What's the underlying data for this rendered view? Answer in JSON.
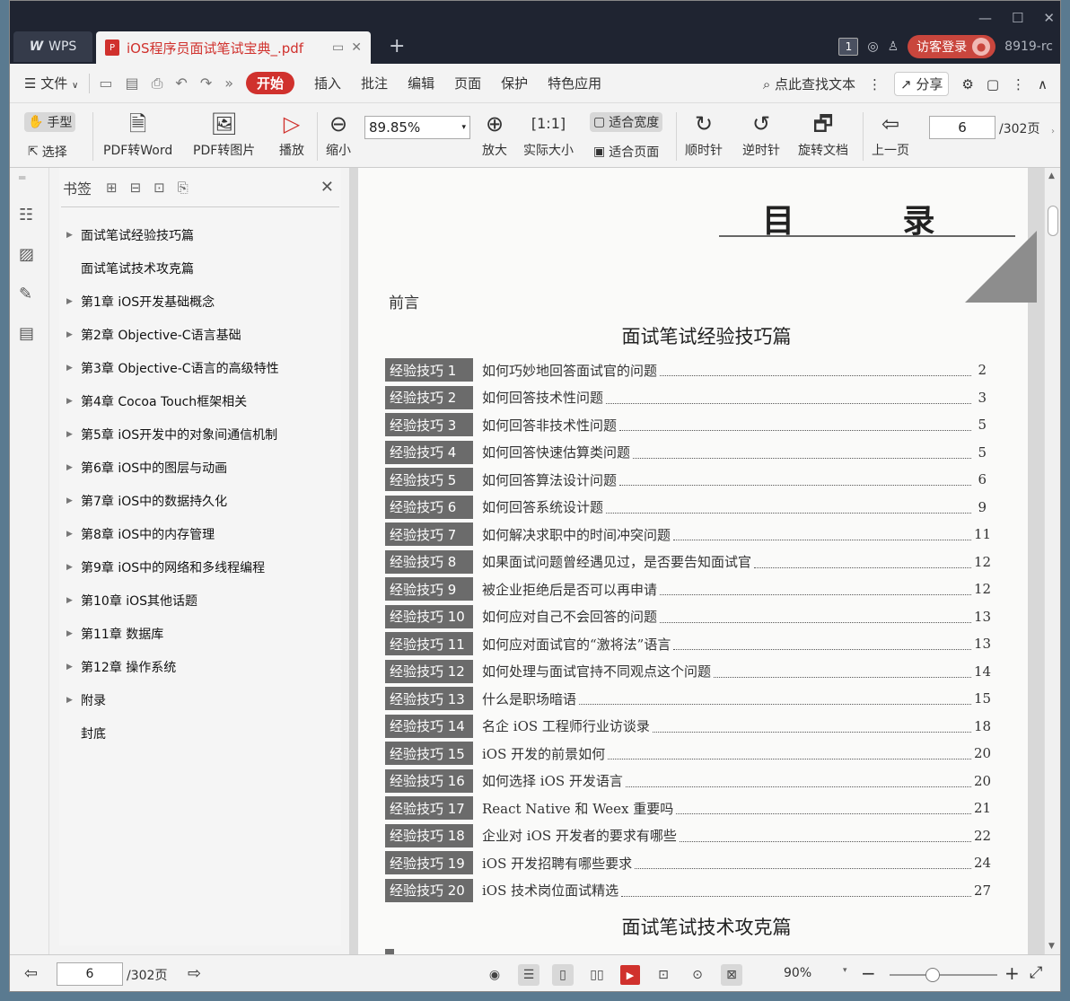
{
  "window": {
    "controls": [
      "minimize",
      "maximize",
      "close"
    ]
  },
  "tabs": {
    "wps_label": "WPS",
    "doc_title": "iOS程序员面试笔试宝典_.pdf",
    "add_label": "+"
  },
  "titlebar_right": {
    "badge": "1",
    "login": "访客登录",
    "version": "8919-rc"
  },
  "menubar": {
    "file": "文件",
    "items": [
      "开始",
      "插入",
      "批注",
      "编辑",
      "页面",
      "保护",
      "特色应用"
    ],
    "search": "点此查找文本",
    "share": "分享"
  },
  "toolbar": {
    "hand": "手型",
    "select": "选择",
    "pdf_to_word": "PDF转Word",
    "pdf_to_image": "PDF转图片",
    "play": "播放",
    "zoom_out": "缩小",
    "zoom_value": "89.85%",
    "zoom_in": "放大",
    "actual_size": "实际大小",
    "fit_width": "适合宽度",
    "fit_page": "适合页面",
    "rotate_cw": "顺时针",
    "rotate_ccw": "逆时针",
    "rotate_doc": "旋转文档",
    "prev_page": "上一页",
    "page_current": "6",
    "page_total": "/302页"
  },
  "bookmarks": {
    "title": "书签",
    "items": [
      {
        "label": "面试笔试经验技巧篇",
        "expandable": true
      },
      {
        "label": "面试笔试技术攻克篇",
        "expandable": false
      },
      {
        "label": "第1章  iOS开发基础概念",
        "expandable": true
      },
      {
        "label": "第2章  Objective-C语言基础",
        "expandable": true
      },
      {
        "label": "第3章  Objective-C语言的高级特性",
        "expandable": true
      },
      {
        "label": "第4章  Cocoa Touch框架相关",
        "expandable": true
      },
      {
        "label": "第5章  iOS开发中的对象间通信机制",
        "expandable": true
      },
      {
        "label": "第6章  iOS中的图层与动画",
        "expandable": true
      },
      {
        "label": "第7章  iOS中的数据持久化",
        "expandable": true
      },
      {
        "label": "第8章  iOS中的内存管理",
        "expandable": true
      },
      {
        "label": "第9章  iOS中的网络和多线程编程",
        "expandable": true
      },
      {
        "label": "第10章  iOS其他话题",
        "expandable": true
      },
      {
        "label": "第11章  数据库",
        "expandable": true
      },
      {
        "label": "第12章  操作系统",
        "expandable": true
      },
      {
        "label": "附录",
        "expandable": true
      },
      {
        "label": "封底",
        "expandable": false
      }
    ]
  },
  "page": {
    "title": "目 录",
    "preface": "前言",
    "section1": "面试笔试经验技巧篇",
    "section2": "面试笔试技术攻克篇",
    "toc": [
      {
        "label": "经验技巧 1",
        "text": "如何巧妙地回答面试官的问题",
        "page": "2"
      },
      {
        "label": "经验技巧 2",
        "text": "如何回答技术性问题",
        "page": "3"
      },
      {
        "label": "经验技巧 3",
        "text": "如何回答非技术性问题",
        "page": "5"
      },
      {
        "label": "经验技巧 4",
        "text": "如何回答快速估算类问题",
        "page": "5"
      },
      {
        "label": "经验技巧 5",
        "text": "如何回答算法设计问题",
        "page": "6"
      },
      {
        "label": "经验技巧 6",
        "text": "如何回答系统设计题",
        "page": "9"
      },
      {
        "label": "经验技巧 7",
        "text": "如何解决求职中的时间冲突问题",
        "page": "11"
      },
      {
        "label": "经验技巧 8",
        "text": "如果面试问题曾经遇见过，是否要告知面试官",
        "page": "12"
      },
      {
        "label": "经验技巧 9",
        "text": "被企业拒绝后是否可以再申请",
        "page": "12"
      },
      {
        "label": "经验技巧 10",
        "text": "如何应对自己不会回答的问题",
        "page": "13"
      },
      {
        "label": "经验技巧 11",
        "text": "如何应对面试官的“激将法”语言",
        "page": "13"
      },
      {
        "label": "经验技巧 12",
        "text": "如何处理与面试官持不同观点这个问题",
        "page": "14"
      },
      {
        "label": "经验技巧 13",
        "text": "什么是职场暗语",
        "page": "15"
      },
      {
        "label": "经验技巧 14",
        "text": "名企 iOS 工程师行业访谈录",
        "page": "18"
      },
      {
        "label": "经验技巧 15",
        "text": "iOS 开发的前景如何",
        "page": "20"
      },
      {
        "label": "经验技巧 16",
        "text": "如何选择 iOS 开发语言",
        "page": "20"
      },
      {
        "label": "经验技巧 17",
        "text": "React Native  和 Weex 重要吗",
        "page": "21"
      },
      {
        "label": "经验技巧 18",
        "text": "企业对 iOS 开发者的要求有哪些",
        "page": "22"
      },
      {
        "label": "经验技巧 19",
        "text": "iOS 开发招聘有哪些要求",
        "page": "24"
      },
      {
        "label": "经验技巧 20",
        "text": "iOS 技术岗位面试精选",
        "page": "27"
      }
    ]
  },
  "statusbar": {
    "page_current": "6",
    "page_total": "/302页",
    "zoom": "90%",
    "zoom_fraction": 0.4
  }
}
